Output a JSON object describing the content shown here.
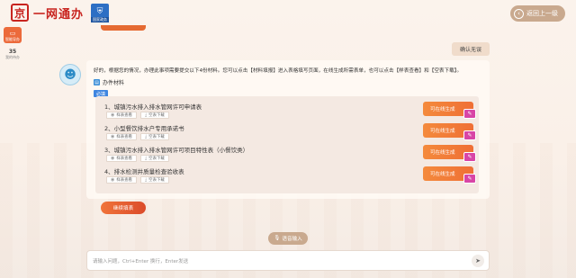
{
  "header": {
    "logo_glyph": "京",
    "logo_text": "一网通办",
    "badge_icon": "document-shield-icon",
    "badge_text": "国家政务",
    "back_label": "返回上一级"
  },
  "sidebar": {
    "assistant_label": "智能导办",
    "count_value": "35",
    "count_label": "我的待办"
  },
  "chat": {
    "user_message": "确认无误",
    "answer_text": "好的，根据您的情况，办理此事项需要提交以下4份材料。您可以点击【材料填报】进入表格填写页面，在线生成所需表单，也可以点击【样表查看】和【空表下载】。",
    "materials_title": "办件材料",
    "must_tag": "必填",
    "materials": [
      {
        "name": "1、城镇污水排入排水管网许可申请表",
        "btn1": "样表查看",
        "btn2": "空表下载",
        "gen": "可在线生成"
      },
      {
        "name": "2、小型餐饮排水户专用承诺书",
        "btn1": "样表查看",
        "btn2": "空表下载",
        "gen": "可在线生成"
      },
      {
        "name": "3、城镇污水排入排水管网许可项目特性表（小餐饮类）",
        "btn1": "样表查看",
        "btn2": "空表下载",
        "gen": "可在线生成"
      },
      {
        "name": "4、排水检测井质量检查验收表",
        "btn1": "样表查看",
        "btn2": "空表下载",
        "gen": "可在线生成"
      }
    ],
    "continue_label": "继续填表"
  },
  "voice_label": "语音输入",
  "input": {
    "placeholder": "请输入问题，Ctrl+Enter 换行，Enter发送",
    "value": ""
  },
  "colors": {
    "brand_red": "#c8241f",
    "accent_orange": "#ef6f35",
    "tag_blue": "#3f86e0"
  }
}
